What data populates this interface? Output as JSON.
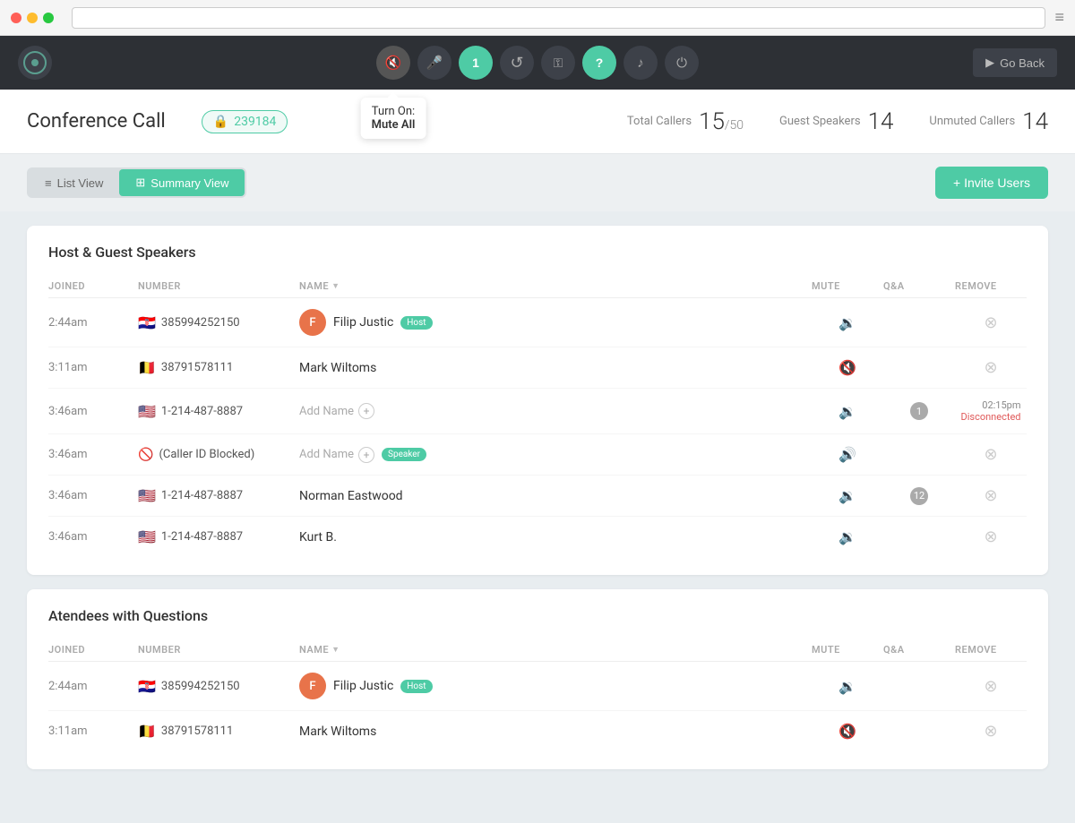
{
  "titlebar": {
    "url_placeholder": ""
  },
  "topnav": {
    "go_back": "Go Back",
    "tooltip_title": "Turn On:",
    "tooltip_action": "Mute All",
    "buttons": [
      {
        "id": "mute-all",
        "icon": "🔇",
        "active": "dark",
        "label": "Mute All"
      },
      {
        "id": "mic",
        "icon": "🎤",
        "active": "none",
        "label": "Microphone"
      },
      {
        "id": "callers",
        "icon": "1",
        "active": "green",
        "label": "Callers"
      },
      {
        "id": "refresh",
        "icon": "↺",
        "active": "none",
        "label": "Refresh"
      },
      {
        "id": "key",
        "icon": "⚿",
        "active": "none",
        "label": "Key"
      },
      {
        "id": "help",
        "icon": "?",
        "active": "green",
        "label": "Help"
      },
      {
        "id": "music",
        "icon": "♪",
        "active": "none",
        "label": "Music"
      },
      {
        "id": "power",
        "icon": "⏻",
        "active": "none",
        "label": "Power"
      }
    ]
  },
  "header": {
    "title": "Conference Call",
    "badge_number": "239184",
    "stats": {
      "total_callers_label": "Total Callers",
      "total_callers_value": "15",
      "total_callers_max": "50",
      "guest_speakers_label": "Guest Speakers",
      "guest_speakers_value": "14",
      "unmuted_callers_label": "Unmuted Callers",
      "unmuted_callers_value": "14"
    }
  },
  "viewbar": {
    "list_view_label": "List View",
    "summary_view_label": "Summary View",
    "invite_label": "+ Invite Users"
  },
  "host_section": {
    "title": "Host & Guest Speakers",
    "columns": {
      "joined": "JOINED",
      "number": "NUMBER",
      "name": "NAME",
      "mute": "MUTE",
      "qa": "Q&A",
      "remove": "REMOVE"
    },
    "rows": [
      {
        "joined": "2:44am",
        "flag": "🇭🇷",
        "number": "385994252150",
        "has_avatar": true,
        "avatar_letter": "F",
        "name": "Filip Justic",
        "badge": "Host",
        "badge_type": "host",
        "muted": false,
        "mute_active": false,
        "qa_count": null,
        "disconnected": false
      },
      {
        "joined": "3:11am",
        "flag": "🇧🇪",
        "number": "38791578111",
        "has_avatar": false,
        "name": "Mark Wiltoms",
        "badge": null,
        "muted": true,
        "mute_active": false,
        "qa_count": null,
        "disconnected": false
      },
      {
        "joined": "3:46am",
        "flag": "🇺🇸",
        "number": "1-214-487-8887",
        "has_avatar": false,
        "name": "Add Name",
        "is_add_name": true,
        "badge": null,
        "muted": false,
        "mute_active": false,
        "qa_count": 1,
        "qa_type": "gray",
        "disconnected": true,
        "disconnect_time": "02:15pm",
        "disconnect_label": "Disconnected"
      },
      {
        "joined": "3:46am",
        "flag": "🚫",
        "number": "(Caller ID Blocked)",
        "has_avatar": false,
        "name": "Add Name",
        "is_add_name": true,
        "badge": "Speaker",
        "badge_type": "speaker",
        "muted": false,
        "mute_active": true,
        "qa_count": null,
        "disconnected": false
      },
      {
        "joined": "3:46am",
        "flag": "🇺🇸",
        "number": "1-214-487-8887",
        "has_avatar": false,
        "name": "Norman Eastwood",
        "badge": null,
        "muted": false,
        "mute_active": false,
        "qa_count": 12,
        "qa_type": "gray",
        "disconnected": false
      },
      {
        "joined": "3:46am",
        "flag": "🇺🇸",
        "number": "1-214-487-8887",
        "has_avatar": false,
        "name": "Kurt B.",
        "badge": null,
        "muted": false,
        "mute_active": false,
        "qa_count": null,
        "disconnected": false
      }
    ]
  },
  "attendees_section": {
    "title": "Atendees with Questions",
    "columns": {
      "joined": "JOINED",
      "number": "NUMBER",
      "name": "NAME",
      "mute": "MUTE",
      "qa": "Q&A",
      "remove": "REMOVE"
    },
    "rows": [
      {
        "joined": "2:44am",
        "flag": "🇭🇷",
        "number": "385994252150",
        "has_avatar": true,
        "avatar_letter": "F",
        "name": "Filip Justic",
        "badge": "Host",
        "badge_type": "host",
        "muted": false,
        "mute_active": false,
        "qa_count": null,
        "disconnected": false
      },
      {
        "joined": "3:11am",
        "flag": "🇧🇪",
        "number": "38791578111",
        "has_avatar": false,
        "name": "Mark Wiltoms",
        "badge": null,
        "muted": true,
        "mute_active": false,
        "qa_count": null,
        "disconnected": false
      }
    ]
  }
}
